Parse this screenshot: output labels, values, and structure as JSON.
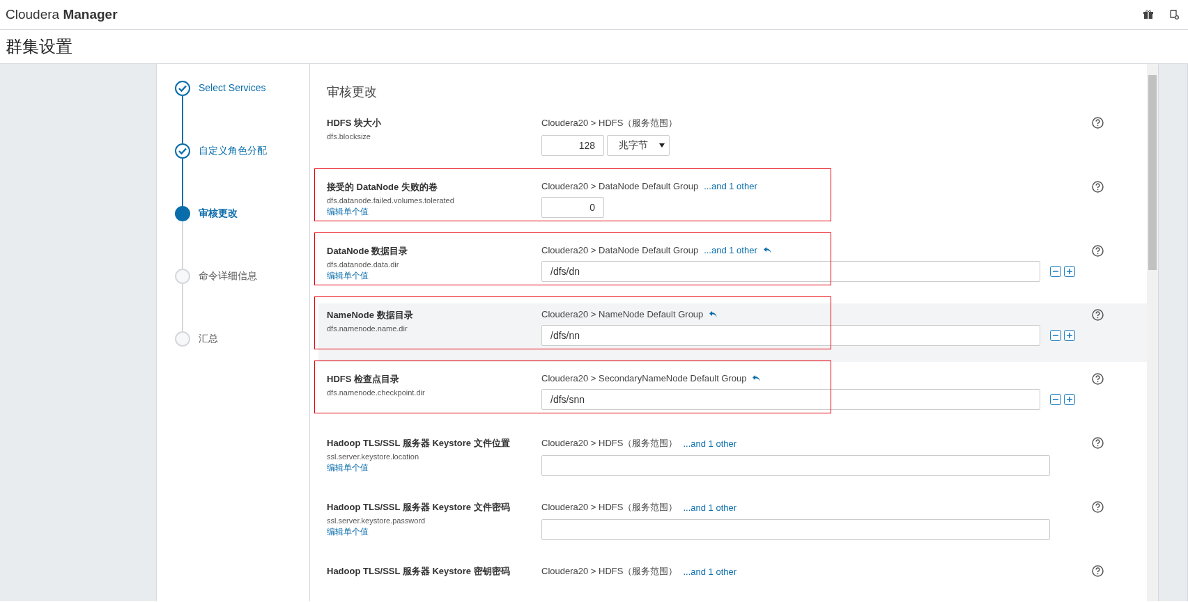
{
  "app": {
    "brand_light": "Cloudera",
    "brand_bold": "Manager"
  },
  "page_title": "群集设置",
  "steps": [
    {
      "label": "Select Services",
      "completed": true,
      "selected": false
    },
    {
      "label": "自定义角色分配",
      "completed": true,
      "selected": false
    },
    {
      "label": "审核更改",
      "completed": false,
      "selected": true
    },
    {
      "label": "命令详细信息",
      "completed": false,
      "selected": false
    },
    {
      "label": "汇总",
      "completed": false,
      "selected": false
    }
  ],
  "section_title": "审核更改",
  "rows": [
    {
      "kind": "number_unit",
      "label": "HDFS 块大小",
      "property": "dfs.blocksize",
      "scope": "Cloudera20 > HDFS（服务范围）",
      "value": "128",
      "unit": "兆字节",
      "revert": false,
      "highlighted": false,
      "shaded": false
    },
    {
      "kind": "number",
      "label": "接受的 DataNode 失败的卷",
      "property": "dfs.datanode.failed.volumes.tolerated",
      "edit_link": "编辑单个值",
      "scope": "Cloudera20 > DataNode Default Group",
      "other_link": "...and 1 other",
      "value": "0",
      "revert": false,
      "highlighted": true,
      "shaded": false
    },
    {
      "kind": "path",
      "label": "DataNode 数据目录",
      "property": "dfs.datanode.data.dir",
      "edit_link": "编辑单个值",
      "scope": "Cloudera20 > DataNode Default Group",
      "other_link": "...and 1 other",
      "value": "/dfs/dn",
      "revert": true,
      "highlighted": true,
      "shaded": false
    },
    {
      "kind": "path",
      "label": "NameNode 数据目录",
      "property": "dfs.namenode.name.dir",
      "scope": "Cloudera20 > NameNode Default Group",
      "value": "/dfs/nn",
      "revert": true,
      "highlighted": true,
      "shaded": true
    },
    {
      "kind": "path",
      "label": "HDFS 检查点目录",
      "property": "dfs.namenode.checkpoint.dir",
      "scope": "Cloudera20 > SecondaryNameNode Default Group",
      "value": "/dfs/snn",
      "revert": true,
      "highlighted": true,
      "shaded": false
    },
    {
      "kind": "text",
      "label": "Hadoop TLS/SSL 服务器 Keystore 文件位置",
      "property": "ssl.server.keystore.location",
      "edit_link": "编辑单个值",
      "scope": "Cloudera20 > HDFS（服务范围）",
      "other_link": "...and 1 other",
      "revert": false,
      "highlighted": false,
      "shaded": false
    },
    {
      "kind": "text",
      "label": "Hadoop TLS/SSL 服务器 Keystore 文件密码",
      "property": "ssl.server.keystore.password",
      "edit_link": "编辑单个值",
      "scope": "Cloudera20 > HDFS（服务范围）",
      "other_link": "...and 1 other",
      "revert": false,
      "highlighted": false,
      "shaded": false
    },
    {
      "kind": "cut",
      "label": "Hadoop TLS/SSL 服务器 Keystore 密钥密码",
      "scope": "Cloudera20 > HDFS（服务范围）",
      "other_link": "...and 1 other",
      "revert": false,
      "highlighted": false,
      "shaded": false
    }
  ]
}
